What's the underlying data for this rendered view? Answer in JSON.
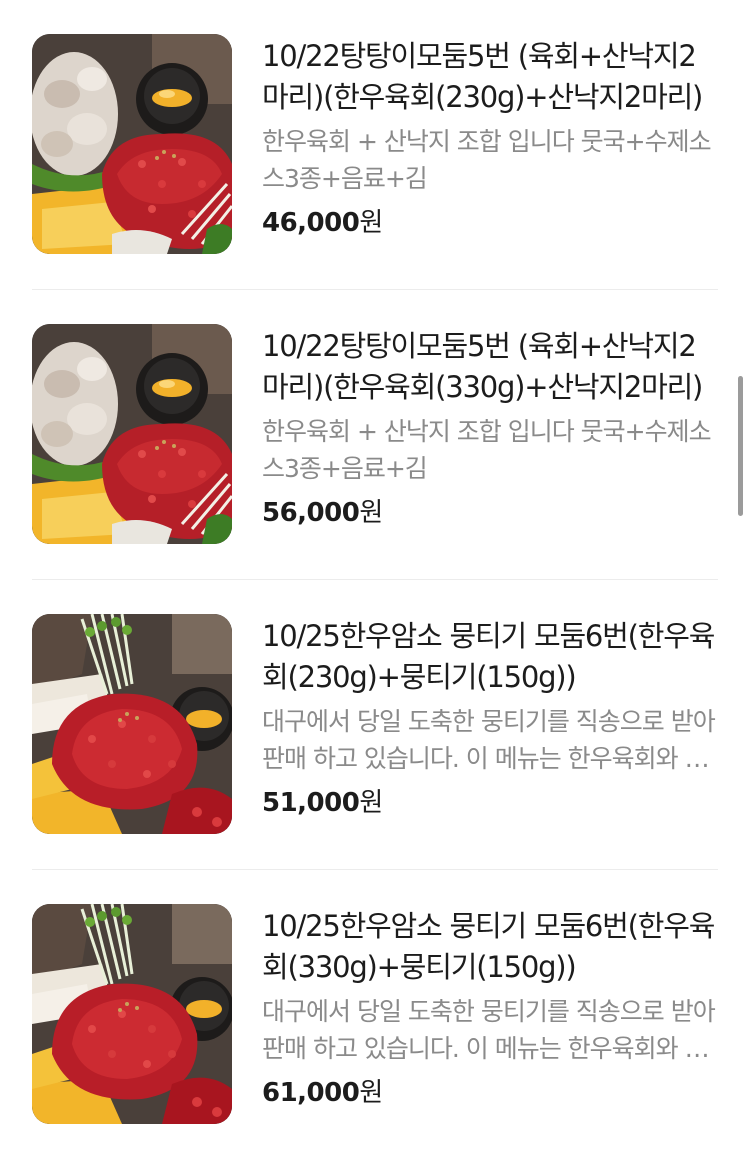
{
  "menu": {
    "items": [
      {
        "title": "10/22탕탕이모둠5번 (육회+산낙지2마리)(한우육회(230g)+산낙지2마리)",
        "description": "한우육회 + 산낙지 조합 입니다 뭇국+수제소스3종+음료+김",
        "price": "46,000",
        "currency": "원",
        "image": "yukhoe-sannakji-platter"
      },
      {
        "title": "10/22탕탕이모둠5번 (육회+산낙지2마리)(한우육회(330g)+산낙지2마리)",
        "description": "한우육회 + 산낙지 조합 입니다 뭇국+수제소스3종+음료+김",
        "price": "56,000",
        "currency": "원",
        "image": "yukhoe-sannakji-platter"
      },
      {
        "title": "10/25한우암소 뭉티기 모둠6번(한우육회(230g)+뭉티기(150g))",
        "description": "대구에서 당일 도축한 뭉티기를 직송으로 받아 판매 하고 있습니다. 이 메뉴는 한우육회와 뭉티기 조합입니다",
        "price": "51,000",
        "currency": "원",
        "image": "yukhoe-mungtigi-platter"
      },
      {
        "title": "10/25한우암소 뭉티기 모둠6번(한우육회(330g)+뭉티기(150g))",
        "description": "대구에서 당일 도축한 뭉티기를 직송으로 받아 판매 하고 있습니다. 이 메뉴는 한우육회와 뭉티기 조합입니다",
        "price": "61,000",
        "currency": "원",
        "image": "yukhoe-mungtigi-platter"
      }
    ]
  },
  "colors": {
    "title": "#1c1c1c",
    "description": "#8a8a8a",
    "divider": "#ececec",
    "scrollbar": "#9b9b9b"
  }
}
